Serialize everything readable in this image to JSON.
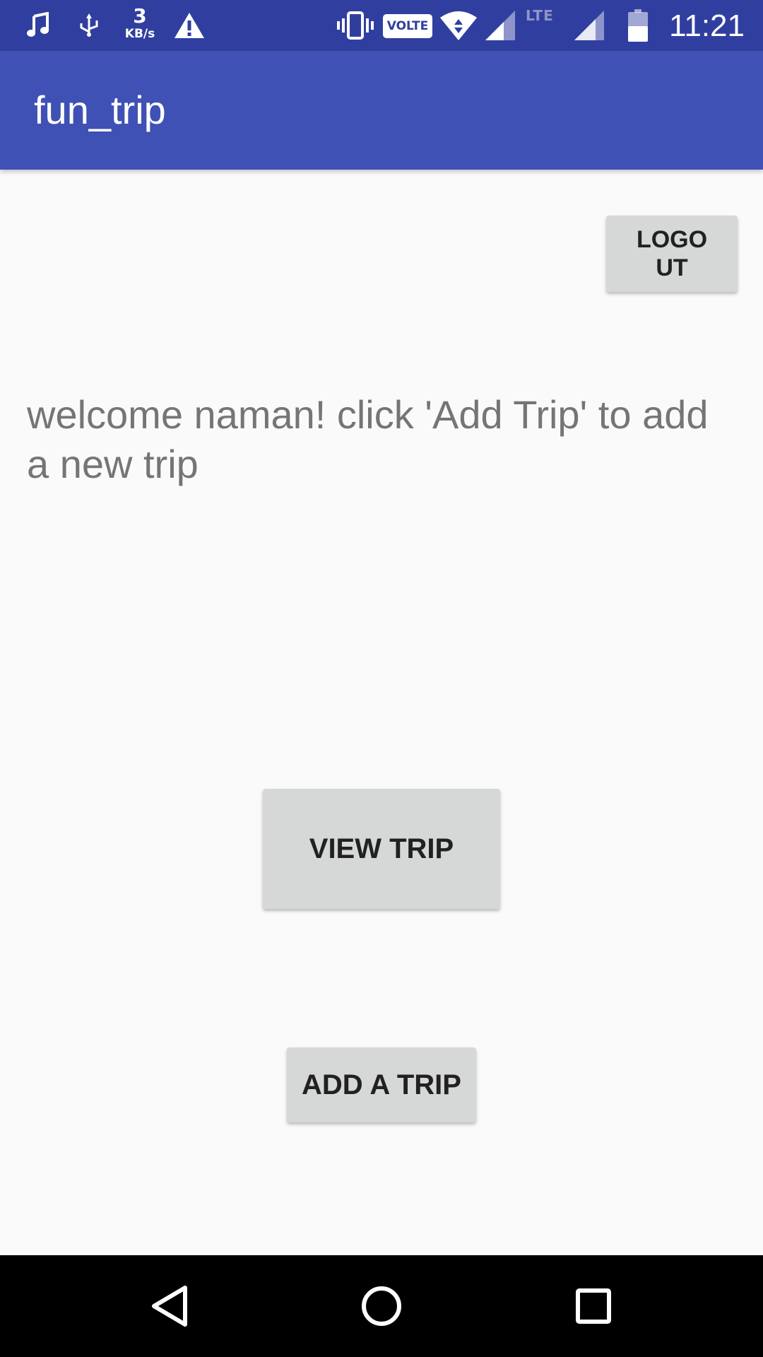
{
  "status_bar": {
    "icons": [
      "music-note-icon",
      "usb-debug-icon",
      "warning-icon",
      "vibrate-icon",
      "wifi-icon",
      "cell-signal-icon",
      "cell-signal-2-icon",
      "battery-icon"
    ],
    "net_speed_value": "3",
    "net_speed_unit": "KB/s",
    "volte_label": "VOLTE",
    "lte_label": "LTE",
    "time": "11:21",
    "background_color": "#303f9f"
  },
  "app_bar": {
    "title": "fun_trip",
    "background_color": "#3f51b5"
  },
  "main": {
    "logout_label": "LOGOUT",
    "welcome_text": "welcome naman! click 'Add Trip' to add a new trip",
    "view_trip_label": "VIEW TRIP",
    "add_trip_label": "ADD A TRIP"
  },
  "nav_bar": {
    "icons": [
      "back-icon",
      "home-icon",
      "recents-icon"
    ]
  }
}
